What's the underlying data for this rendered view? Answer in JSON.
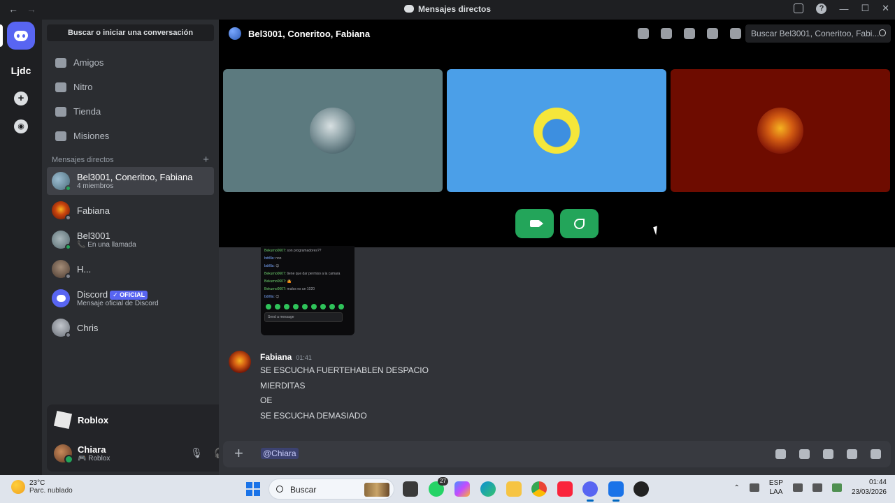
{
  "window": {
    "title": "Mensajes directos"
  },
  "servers": {
    "home_label": "Discord",
    "server_abbr": "Ljdc",
    "add_label": "+"
  },
  "sidebar": {
    "search_button": "Buscar o iniciar una conversación",
    "nav": [
      {
        "label": "Amigos",
        "icon": "friends-icon"
      },
      {
        "label": "Nitro",
        "icon": "nitro-icon"
      },
      {
        "label": "Tienda",
        "icon": "shop-icon"
      },
      {
        "label": "Misiones",
        "icon": "quests-icon"
      }
    ],
    "dm_header": "Mensajes directos",
    "dm_add": "+",
    "dms": [
      {
        "name": "Bel3001, Coneritoo, Fabiana",
        "sub": "4 miembros"
      },
      {
        "name": "Fabiana",
        "sub": ""
      },
      {
        "name": "Bel3001",
        "sub": "📞 En una llamada"
      },
      {
        "name": "H...",
        "sub": ""
      },
      {
        "name": "Discord",
        "badge": "✓ OFICIAL",
        "sub": "Mensaje oficial de Discord"
      },
      {
        "name": "Chris",
        "sub": ""
      }
    ],
    "activity": {
      "name": "Roblox"
    },
    "user": {
      "name": "Chiara",
      "status": "🎮 Roblox"
    }
  },
  "channel": {
    "name": "Bel3001, Coneritoo, Fabiana",
    "search_placeholder": "Buscar Bel3001, Coneritoo, Fabi..."
  },
  "call": {
    "tiles": [
      {
        "name": "seal-avatar",
        "bg": "#5c7a7f"
      },
      {
        "name": "blue-creature-avatar",
        "bg": "#4b9fe8"
      },
      {
        "name": "lily-flower-avatar",
        "bg": "#6e0c00"
      }
    ]
  },
  "screenshot_preview": {
    "lines": [
      {
        "user": "Bekurno0607:",
        "text": " son programadores??",
        "kind": "g"
      },
      {
        "user": "bdrllla:",
        "text": " noo",
        "kind": "b"
      },
      {
        "user": "bdrllla:",
        "text": " 😊",
        "kind": "b"
      },
      {
        "user": "Bekurno0607:",
        "text": " tiene que dar permiso a la camara",
        "kind": "g"
      },
      {
        "user": "Bekurno0607:",
        "text": " 🤷",
        "kind": "g"
      },
      {
        "user": "Bekurno0607:",
        "text": " malos es un 1020",
        "kind": "g"
      },
      {
        "user": "bdrllla:",
        "text": " 😊",
        "kind": "b"
      }
    ],
    "input": "Send a message"
  },
  "message": {
    "author": "Fabiana",
    "time": "01:41",
    "lines": [
      "SE ESCUCHA FUERTEHABLEN DESPACIO",
      "MIERDITAS",
      "OE",
      "SE ESCUCHA DEMASIADO"
    ]
  },
  "composer": {
    "mention": "@Chiara"
  },
  "taskbar": {
    "temp": "23°C",
    "weather": "Parc. nublado",
    "search": "Buscar",
    "lang1": "ESP",
    "lang2": "LAA",
    "time": "01:44",
    "date": "23/03/2026",
    "whatsapp_badge": "27"
  }
}
